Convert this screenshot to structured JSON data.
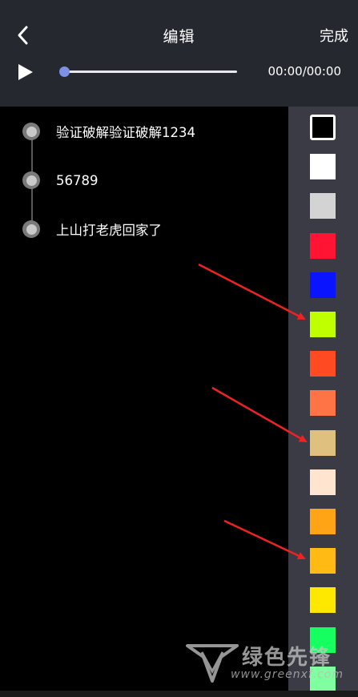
{
  "header": {
    "title": "编辑",
    "done_label": "完成",
    "back_icon": "chevron-left-icon"
  },
  "player": {
    "play_icon": "play-icon",
    "time": "00:00/00:00",
    "progress": 0,
    "knob_color": "#7d8fe6"
  },
  "lyrics": {
    "items": [
      {
        "label": "验证破解验证破解1234"
      },
      {
        "label": "56789"
      },
      {
        "label": "上山打老虎回家了"
      }
    ]
  },
  "palette": {
    "colors": [
      "#000000",
      "#ffffff",
      "#d3d3d3",
      "#ff1434",
      "#0a14ff",
      "#c0ff00",
      "#ff4a22",
      "#ff7447",
      "#e0c07f",
      "#ffe4d0",
      "#ffa414",
      "#ffbb14",
      "#ffe800",
      "#16ff60",
      "#7fffa0"
    ],
    "selected_index": 0
  },
  "watermark": {
    "text": "绿色先锋",
    "url": "www.greenxf.com"
  }
}
